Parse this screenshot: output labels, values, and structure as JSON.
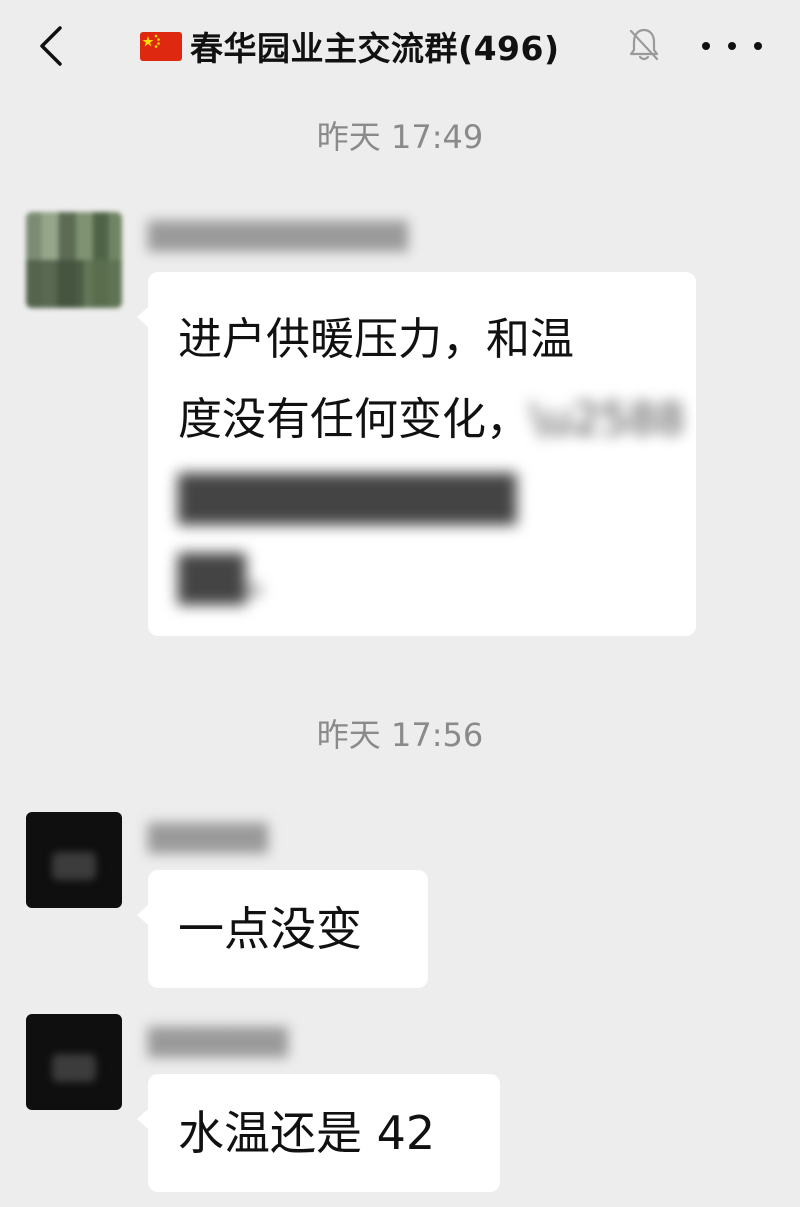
{
  "header": {
    "title": "春华园业主交流群(496)",
    "flag_icon": "china-flag-emoji",
    "back_icon": "chevron-left-icon",
    "mute_icon": "bell-off-icon",
    "more_icon": "more-dots-icon"
  },
  "messages": [
    {
      "timestamp": "昨天 17:49",
      "sender": "█████████████",
      "avatar": "blurred-green-avatar",
      "lines": [
        "进户供暖压力，和温",
        "度没有任何变化，"
      ],
      "blurred_lines": [
        "██████████",
        "██。"
      ]
    },
    {
      "timestamp": "昨天 17:56",
      "sender": "██████",
      "avatar": "blurred-dark-avatar",
      "text": "一点没变"
    },
    {
      "sender": "███████",
      "avatar": "blurred-dark-avatar",
      "text": "水温还是 42"
    }
  ],
  "colors": {
    "background": "#ededed",
    "bubble": "#ffffff",
    "timestamp": "#8a8a8a",
    "text": "#111111"
  }
}
